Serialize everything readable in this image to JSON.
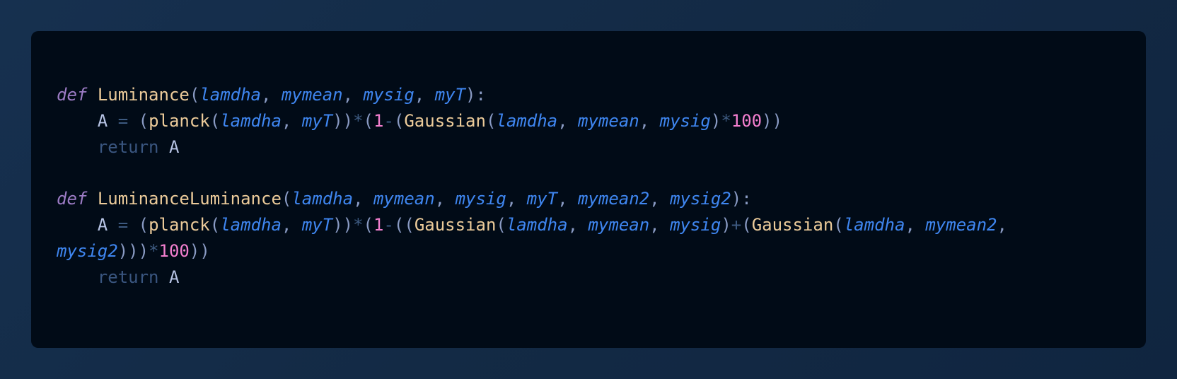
{
  "code": {
    "line1": {
      "kw": "def",
      "fn": "Luminance",
      "open": "(",
      "p1": "lamdha",
      "p2": "mymean",
      "p3": "mysig",
      "p4": "myT",
      "close": "):"
    },
    "line2": {
      "var": "A",
      "eq": "=",
      "fn1": "planck",
      "a1": "lamdha",
      "a2": "myT",
      "mul": "*",
      "one": "1",
      "minus": "-",
      "fn2": "Gaussian",
      "b1": "lamdha",
      "b2": "mymean",
      "b3": "mysig",
      "mul2": "*",
      "hundred": "100"
    },
    "line3": {
      "kw": "return",
      "var": "A"
    },
    "line5": {
      "kw": "def",
      "fn": "LuminanceLuminance",
      "p1": "lamdha",
      "p2": "mymean",
      "p3": "mysig",
      "p4": "myT",
      "p5": "mymean2",
      "p6": "mysig2"
    },
    "line6": {
      "var": "A",
      "eq": "=",
      "fn1": "planck",
      "a1": "lamdha",
      "a2": "myT",
      "mul": "*",
      "one": "1",
      "minus": "-",
      "fn2": "Gaussian",
      "b1": "lamdha",
      "b2": "mymean",
      "b3": "mysig",
      "plus": "+",
      "fn3": "Gaussian",
      "c1": "lamdha",
      "c2": "mymean2",
      "c3": "mysig2",
      "mul2": "*",
      "hundred": "100"
    },
    "line7": {
      "kw": "return",
      "var": "A"
    }
  }
}
